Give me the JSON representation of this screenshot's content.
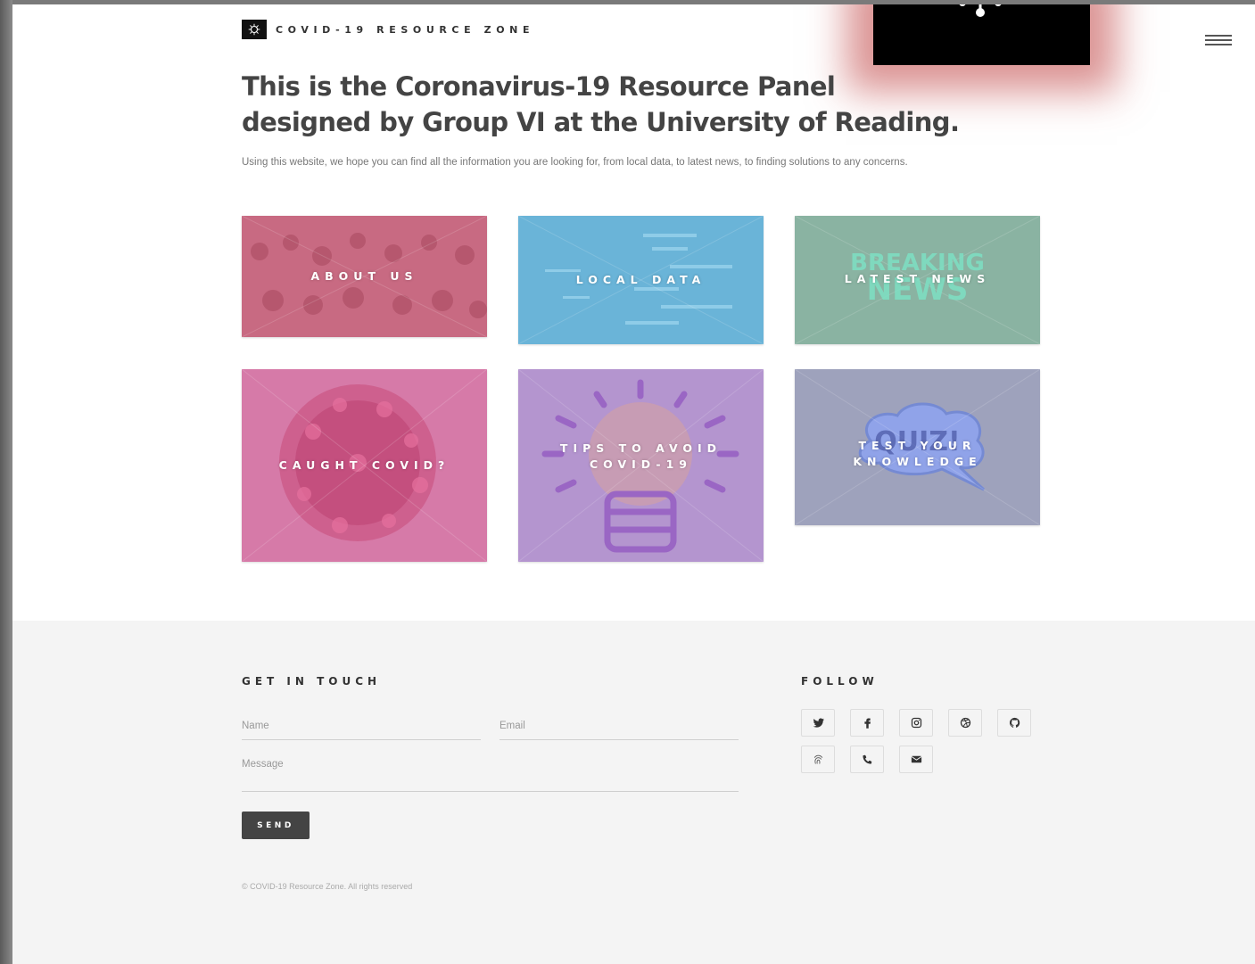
{
  "brand": {
    "name": "COVID-19 RESOURCE ZONE",
    "logo_icon": "virus-icon"
  },
  "menu": {
    "icon": "hamburger-menu-icon"
  },
  "hero": {
    "title_line1": "This is the Coronavirus-19 Resource Panel",
    "title_line2": "designed by Group VI at the University of Reading.",
    "subtitle": "Using this website, we hope you can find all the information you are looking for, from local data, to latest news, to finding solutions to any concerns."
  },
  "tiles": [
    {
      "label": "ABOUT US",
      "color": "#c86a82"
    },
    {
      "label": "LOCAL DATA",
      "color": "#6ab4d8"
    },
    {
      "label": "LATEST NEWS",
      "color": "#8ab3a2",
      "image_text_1": "BREAKING",
      "image_text_2": "NEWS"
    },
    {
      "label": "CAUGHT COVID?",
      "color": "#d67aa8"
    },
    {
      "label_line1": "TIPS TO AVOID",
      "label_line2": "COVID-19",
      "color": "#b495cf"
    },
    {
      "label_line1": "TEST YOUR",
      "label_line2": "KNOWLEDGE",
      "color": "#9ea2bc",
      "image_text": "QUIZ!"
    }
  ],
  "footer": {
    "contact_heading": "GET IN TOUCH",
    "follow_heading": "FOLLOW",
    "name_placeholder": "Name",
    "email_placeholder": "Email",
    "message_placeholder": "Message",
    "send_label": "SEND",
    "copyright": "© COVID-19 Resource Zone. All rights reserved",
    "social_icons": [
      "twitter-icon",
      "facebook-icon",
      "instagram-icon",
      "dribbble-icon",
      "github-icon",
      "fingerprint-icon",
      "phone-icon",
      "envelope-icon"
    ]
  }
}
